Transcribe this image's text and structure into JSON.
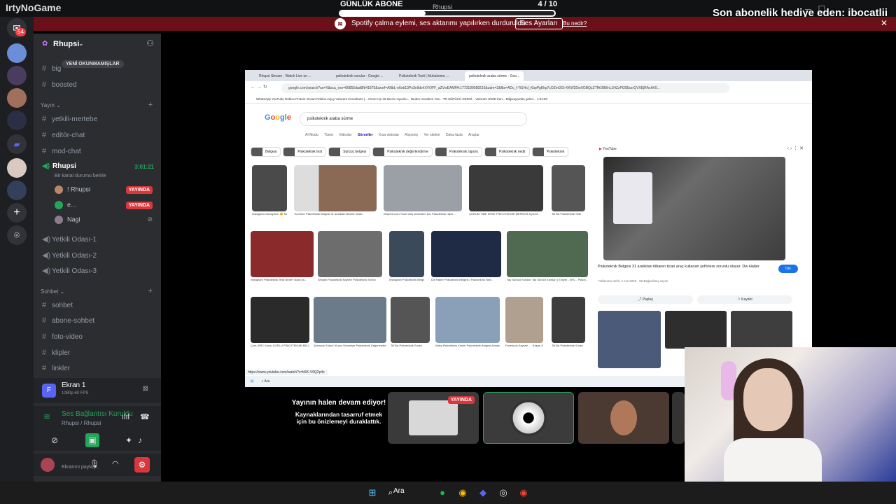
{
  "top": {
    "logo_text": "IrtyNoGame",
    "sub_goal_label": "GÜNLÜK ABONE",
    "sub_goal_count": "4 / 10",
    "sub_goal_progress": 0.4,
    "sub_goal_server": "Rhupsi",
    "gift_text": "Son abonelik hediye eden: ibocatlii"
  },
  "notice": {
    "message": "Spotify çalma eylemi, ses aktarımı yapılırken durduruldu.",
    "button_label": "Ses Ayarları",
    "link_label": "Bu nedir?"
  },
  "rail": {
    "dm_badge": "54"
  },
  "sidebar": {
    "server_name": "Rhupsi",
    "new_messages": "YENİ OKUNMAMIŞLAR",
    "channels_top": [
      {
        "label": "big"
      },
      {
        "label": "boosted"
      }
    ],
    "cat_yayin": "Yayın",
    "yayin_channels": [
      {
        "label": "yetkili-mertebe"
      },
      {
        "label": "editör-chat"
      },
      {
        "label": "mod-chat"
      }
    ],
    "voice_channel": "Rhupsi",
    "voice_time": "3:01:21",
    "voice_status": "Bir kanal durumu belirle",
    "voice_users": [
      {
        "name": "! Rhupsi",
        "live": "YAYINDA"
      },
      {
        "name": "e...",
        "live": "YAYINDA"
      },
      {
        "name": "Nagi",
        "live": ""
      }
    ],
    "voice_rooms": [
      {
        "label": "Yetkili Odası-1"
      },
      {
        "label": "Yetkili Odası-2"
      },
      {
        "label": "Yetkili Odası-3"
      }
    ],
    "cat_sohbet": "Sohbet",
    "sohbet_channels": [
      {
        "label": "sohbet"
      },
      {
        "label": "abone-sohbet"
      },
      {
        "label": "foto-video"
      },
      {
        "label": "klipler"
      },
      {
        "label": "linkler"
      }
    ],
    "screenshare_title": "Ekran 1",
    "screenshare_quality": "1080p 60 FPS",
    "conn_title": "Ses Bağlantısı Kuruldu",
    "conn_sub": "Rhupsi / Rhupsi",
    "user_status": "Ekranını paylaş..."
  },
  "browser": {
    "tabs": [
      "Rhupsi Stream - Watch Live on ...",
      "psikoteknik sorular - Google ...",
      "Psikoteknik Testi | Muhakeme ...",
      "psikoteknik araba sürme - Goo..."
    ],
    "url": "google.com/search?sa=X&sca_esv=86855dad8fb41875&sxsrf=ANbL-n6ob13Po3n9dvhXVOFF_aZVwEAMPA:1773180088216&udm=2&fbs=ADc_l-YiSHsI_KbpPgKkp7cOZmDGi-KKW2DwXGBQzZTfAOBBnL1HZzPI285szrQVXEjRAchK0...",
    "bookmarks": "WhatsApp  YouTube  Roblox  Protein Ocean  Roblox.enjoy  Valorant Crosshairs |...  Cimer  Hp 15-8s1Xx Uyumlu...  Neden Hesabım Yas...  TR SÜRÜCÜ DERSİ...  Valorant HWID ban...  Bilgisayardan gelen...  1:04:50",
    "query": "psikoteknik araba sürme",
    "search_tabs": [
      "AI Modu",
      "Tümü",
      "Videolar",
      "Görseller",
      "Kısa videolar",
      "Alışveriş",
      "Yer siteleri",
      "Daha fazla",
      "Araçlar"
    ],
    "chips": [
      "Belgesi",
      "Psikoteknik test",
      "Sürücü belgesi",
      "Psikoteknik değerlendirme",
      "Psikoteknik raporu",
      "Psikoteknik nedir",
      "Psikoteknik"
    ],
    "results": [
      "Instagram  Günaydınn 😊 Mü...",
      "YouTube  Psikoteknik Belgesi 31 aralıktan itibaren ticari...",
      "eksperk.com  Ticari araç sürücüleri için Psikoteknik rapor...",
      "ÇORUM TIME  ERSE PSİKOTEKNİK MERKEZİ AÇILDI...",
      "TikTok  Psikoteknik Testi",
      "Instagram  Psikoteknik Testi Nedir? Nasıl ya...",
      "Şimşek Psikoteknik Kayseri  Psikoteknik Sınavı",
      "Instagram  Psikoteknik Belgesi",
      "Dw Haber  Psikoteknik Belgesi | Psikoteknik Ned...",
      "Tay Sürücü Kursları  Tay Sürücü Kursları | Ehliyet - SRC - Psikot...",
      "Çorlu SRC Kursu  ÇORLU PSİKOTEKNİK BELG...",
      "Şehzade Sürücü Kursu  Ümraniye Psikoteknik Değerlendirme |...",
      "TikTok  Psikoteknik Sınavı",
      "Kitley Psikoteknik  Kimler Psikoteknik Belgesi Almalıd...",
      "Facebook  Kayseri... - Keşan S...",
      "TikTok  Psikoteknik Sınavı"
    ],
    "panel_source": "YouTube",
    "panel_title": "Psikoteknik Belgesi 31 aralıktan itibaren ticari araç kullanan şoförlere zorunlu oluyor. Dw Haber",
    "panel_meta": "Yüklenme tarihi: 2 Ara 2020 · 55 Beğenilmiş sayısı",
    "panel_visit": "İzle",
    "panel_share": "Paylaş",
    "panel_save": "Kaydet",
    "status_url": "https://www.youtube.com/watch?v=b5K-V9Q2p4s",
    "taskbar_search": "Ara"
  },
  "stage": {
    "pause_heading": "Yayının halen devam ediyor!",
    "pause_body": "Kaynaklarından tasarruf etmek için bu önizlemeyi duraklattık.",
    "tile_live": "YAYINDA"
  },
  "os": {
    "search_label": "Ara"
  },
  "colors": {
    "discord_bg": "#2b2d31",
    "live_red": "#da373c",
    "notice_red": "#6b1018",
    "online_green": "#23a55a"
  }
}
